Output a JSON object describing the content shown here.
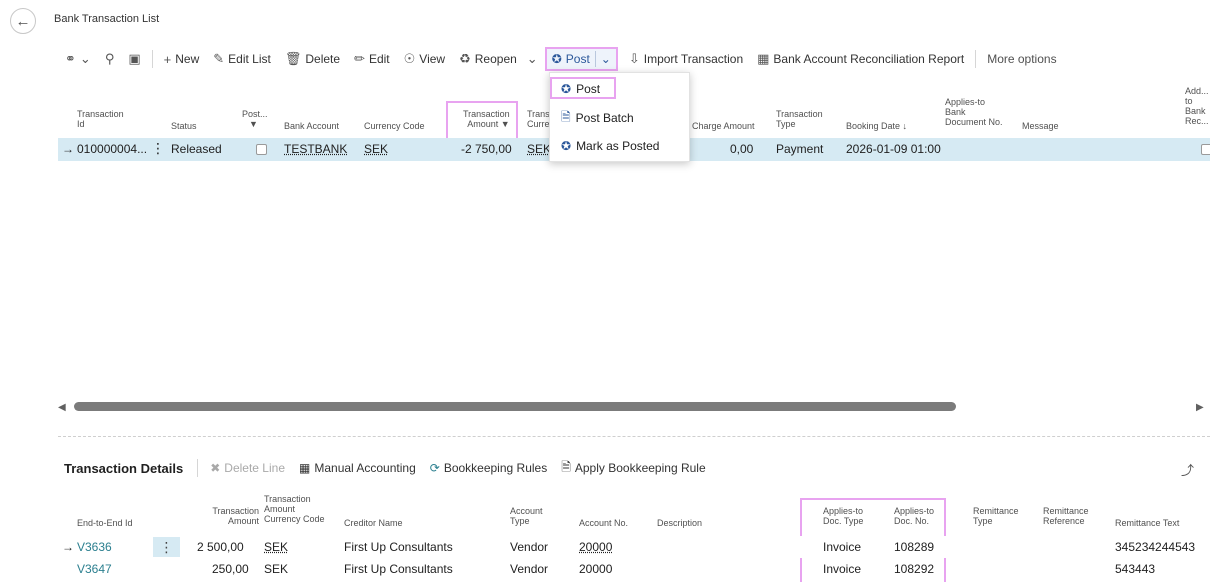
{
  "page": {
    "title": "Bank Transaction List"
  },
  "toolbar": {
    "new": "New",
    "edit_list": "Edit List",
    "delete": "Delete",
    "edit": "Edit",
    "view": "View",
    "reopen": "Reopen",
    "post": "Post",
    "import_transaction": "Import Transaction",
    "bank_account_recon_report": "Bank Account Reconciliation Report",
    "more_options": "More options"
  },
  "post_menu": {
    "post": "Post",
    "post_batch": "Post Batch",
    "mark_as_posted": "Mark as Posted"
  },
  "grid": {
    "headers": {
      "transaction_id": [
        "Transaction",
        "Id"
      ],
      "status": "Status",
      "posted": "Post...",
      "bank_account": "Bank Account",
      "currency_code": "Currency Code",
      "transaction_amount": [
        "Transaction",
        "Amount"
      ],
      "trans_curr": [
        "Trans",
        "Curre"
      ],
      "charge_amount": "Charge Amount",
      "transaction_type": [
        "Transaction",
        "Type"
      ],
      "booking_date": "Booking Date ↓",
      "applies_to_bank_doc": [
        "Applies-to",
        "Bank",
        "Document No."
      ],
      "message": "Message",
      "add_to_bank_rec": [
        "Add...",
        "to",
        "Bank",
        "Rec..."
      ]
    },
    "row": {
      "transaction_id": "010000004...",
      "status": "Released",
      "bank_account": "TESTBANK",
      "currency_code": "SEK",
      "transaction_amount": "-2 750,00",
      "trans_curr": "SEK",
      "charge_amount": "0,00",
      "transaction_type": "Payment",
      "booking_date": "2026-01-09 01:00"
    }
  },
  "details": {
    "title": "Transaction Details",
    "delete_line": "Delete Line",
    "manual_accounting": "Manual Accounting",
    "bookkeeping_rules": "Bookkeeping Rules",
    "apply_bookkeeping_rule": "Apply Bookkeeping Rule",
    "headers": {
      "end_to_end_id": "End-to-End Id",
      "transaction_amount": [
        "Transaction",
        "Amount"
      ],
      "transaction_amount_currency": [
        "Transaction",
        "Amount",
        "Currency Code"
      ],
      "creditor_name": "Creditor Name",
      "account_type": [
        "Account",
        "Type"
      ],
      "account_no": "Account No.",
      "description": "Description",
      "applies_to_doc_type": [
        "Applies-to",
        "Doc. Type"
      ],
      "applies_to_doc_no": [
        "Applies-to",
        "Doc. No."
      ],
      "remittance_type": [
        "Remittance",
        "Type"
      ],
      "remittance_reference": [
        "Remittance",
        "Reference"
      ],
      "remittance_text": "Remittance Text"
    },
    "rows": [
      {
        "end_to_end_id": "V3636",
        "amount": "2 500,00",
        "currency": "SEK",
        "creditor": "First Up Consultants",
        "account_type": "Vendor",
        "account_no": "20000",
        "doc_type": "Invoice",
        "doc_no": "108289",
        "remittance_text": "345234244543"
      },
      {
        "end_to_end_id": "V3647",
        "amount": "250,00",
        "currency": "SEK",
        "creditor": "First Up Consultants",
        "account_type": "Vendor",
        "account_no": "20000",
        "doc_type": "Invoice",
        "doc_no": "108292",
        "remittance_text": "543443"
      }
    ]
  },
  "colors": {
    "accent": "#2b579a",
    "highlight": "#e8a3f0",
    "selected_row": "#d6eaf3",
    "teal": "#2b7f8f"
  }
}
